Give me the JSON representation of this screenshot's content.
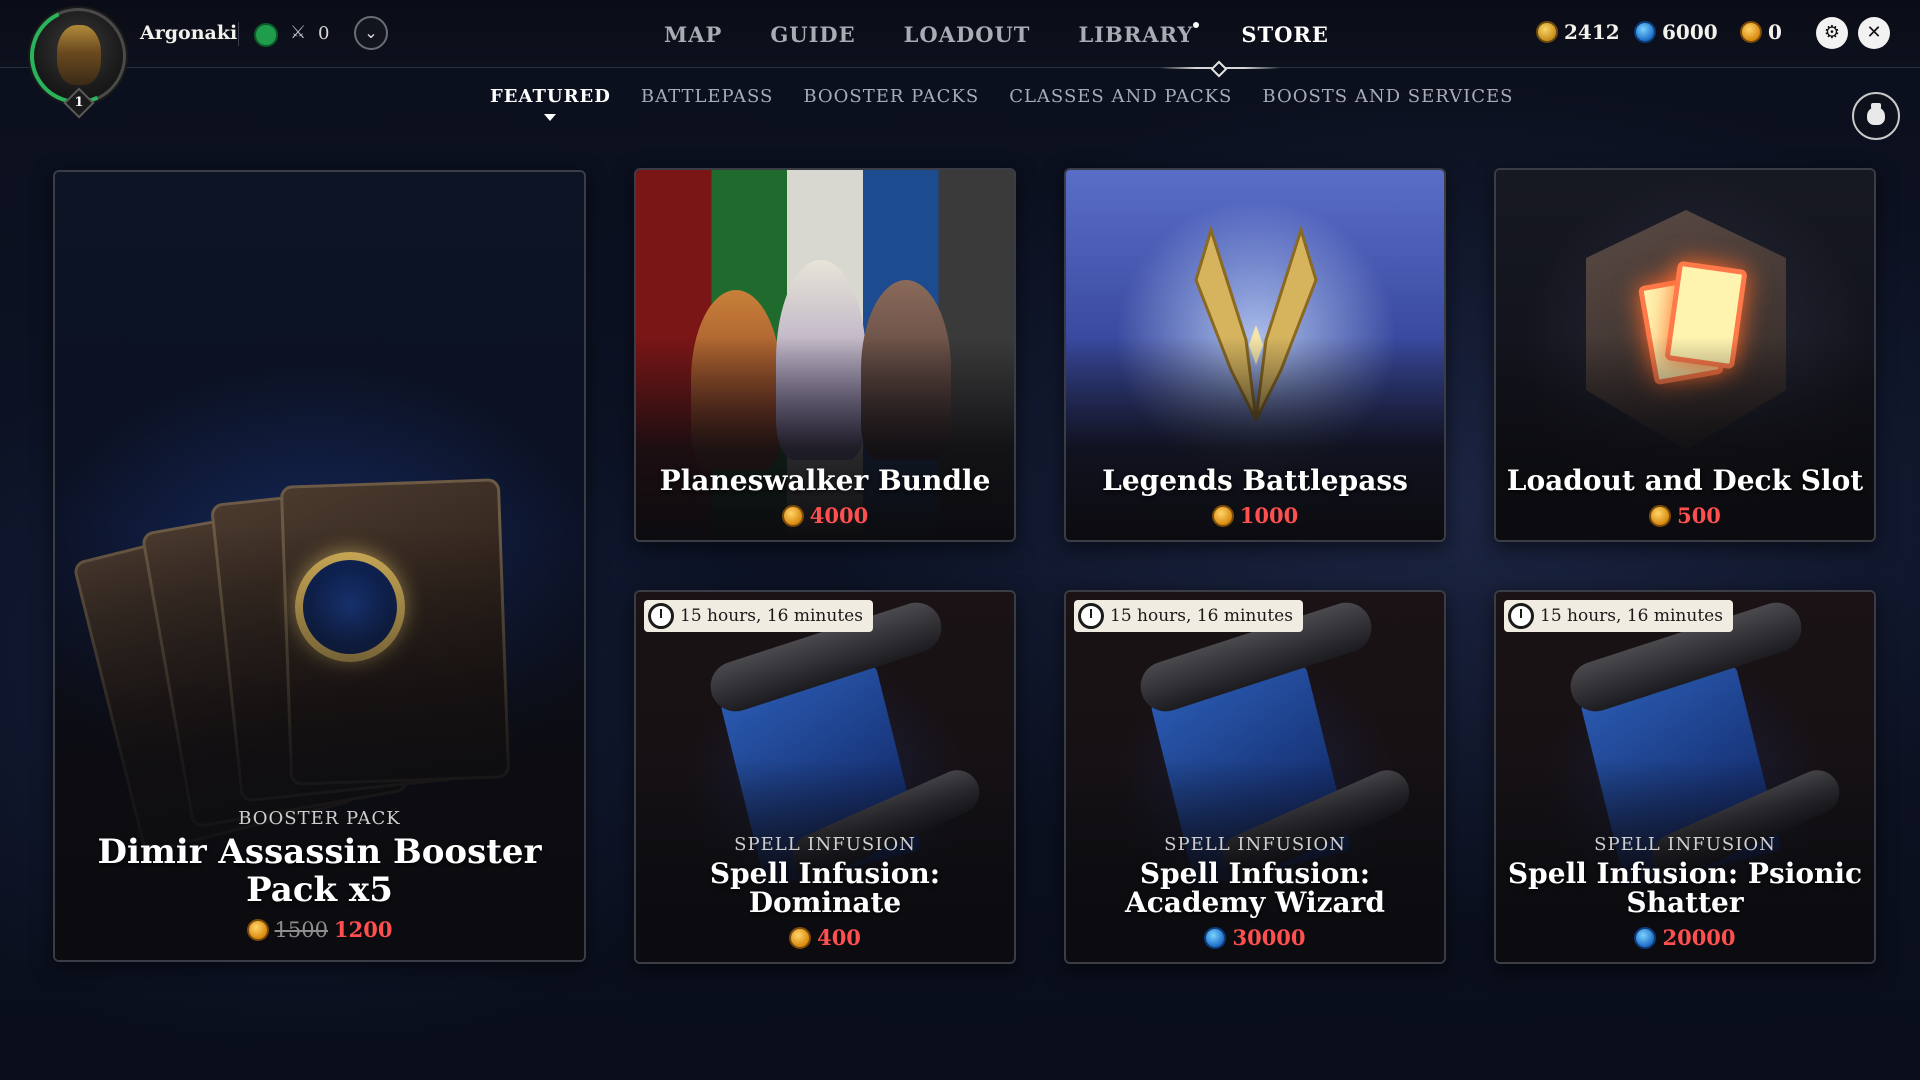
{
  "player": {
    "name": "Argonaki",
    "level": "1",
    "rank_value": "0"
  },
  "nav": {
    "items": [
      "MAP",
      "GUIDE",
      "LOADOUT",
      "LIBRARY",
      "STORE"
    ],
    "active": "STORE"
  },
  "currencies": {
    "gold": "2412",
    "gems": "6000",
    "coins": "0"
  },
  "subnav": {
    "items": [
      "FEATURED",
      "BATTLEPASS",
      "BOOSTER PACKS",
      "CLASSES AND PACKS",
      "BOOSTS AND SERVICES"
    ],
    "active": "FEATURED"
  },
  "cards": {
    "booster": {
      "kicker": "BOOSTER PACK",
      "title": "Dimir Assassin Booster Pack x5",
      "old_price": "1500",
      "price": "1200",
      "currency_icon": "coins-icon"
    },
    "planeswalker": {
      "title": "Planeswalker Bundle",
      "price": "4000",
      "currency_icon": "coins-icon"
    },
    "battlepass": {
      "title": "Legends Battlepass",
      "price": "1000",
      "currency_icon": "coins-icon"
    },
    "loadout": {
      "title": "Loadout and Deck Slot",
      "price": "500",
      "currency_icon": "coins-icon"
    },
    "dominate": {
      "timer": "15 hours, 16 minutes",
      "kicker": "SPELL INFUSION",
      "title": "Spell Infusion: Dominate",
      "price": "400",
      "currency_icon": "coins-icon"
    },
    "academy": {
      "timer": "15 hours, 16 minutes",
      "kicker": "SPELL INFUSION",
      "title": "Spell Infusion: Academy Wizard",
      "price": "30000",
      "currency_icon": "gems-icon"
    },
    "psionic": {
      "timer": "15 hours, 16 minutes",
      "kicker": "SPELL INFUSION",
      "title": "Spell Infusion: Psionic Shatter",
      "price": "20000",
      "currency_icon": "gems-icon"
    }
  },
  "colors": {
    "sale_price": "#ff4f4f",
    "active_nav": "#ffffff",
    "inactive_nav": "#a9acb4"
  }
}
